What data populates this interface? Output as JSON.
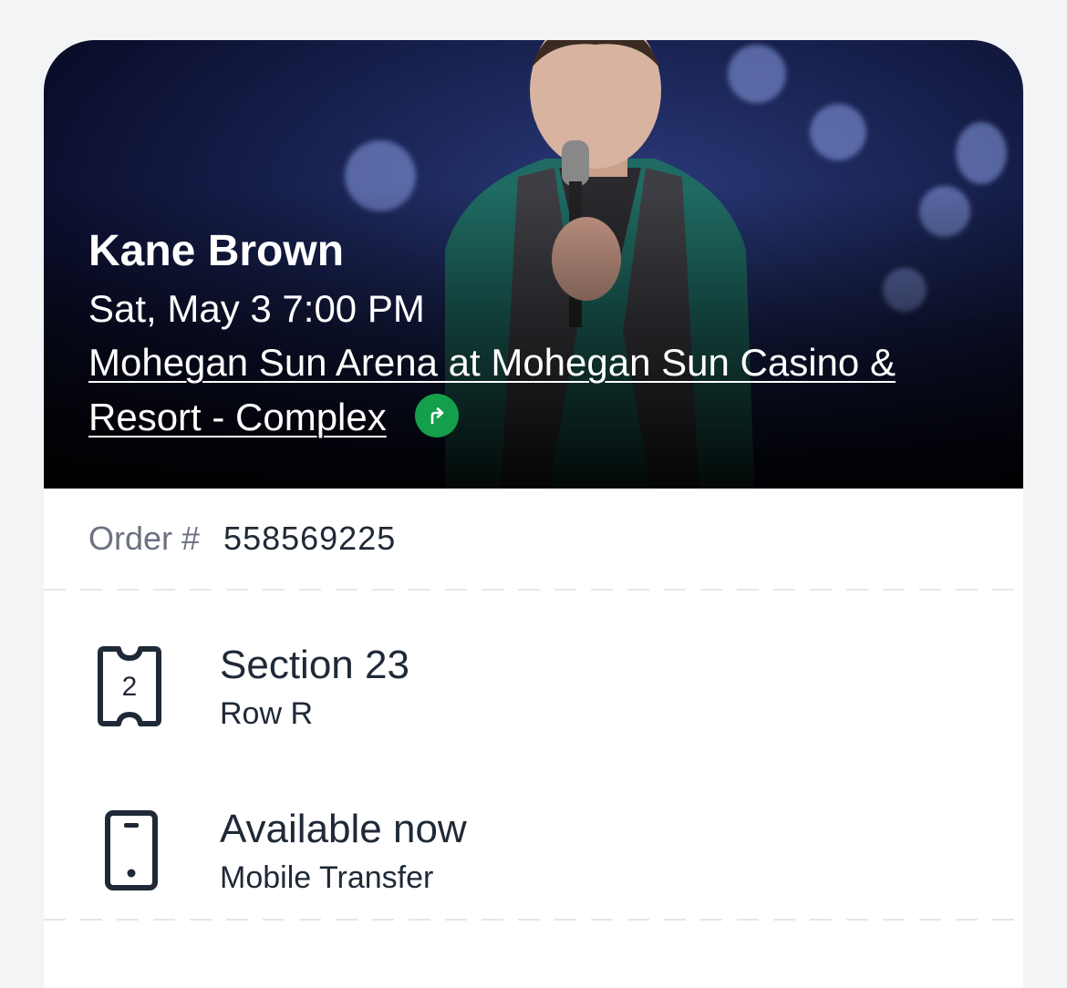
{
  "event": {
    "name": "Kane Brown",
    "datetime": "Sat, May 3 7:00 PM",
    "venue_line1": "Mohegan Sun Arena at Mohegan Sun Casino &",
    "venue_line2": "Resort - Complex"
  },
  "order": {
    "label": "Order #",
    "number": "558569225"
  },
  "seat": {
    "ticket_count": "2",
    "section": "Section 23",
    "row": "Row R"
  },
  "delivery": {
    "status": "Available now",
    "method": "Mobile Transfer"
  },
  "colors": {
    "directions_accent": "#14a04a",
    "text_primary": "#1f2937",
    "text_muted": "#6b7280"
  }
}
